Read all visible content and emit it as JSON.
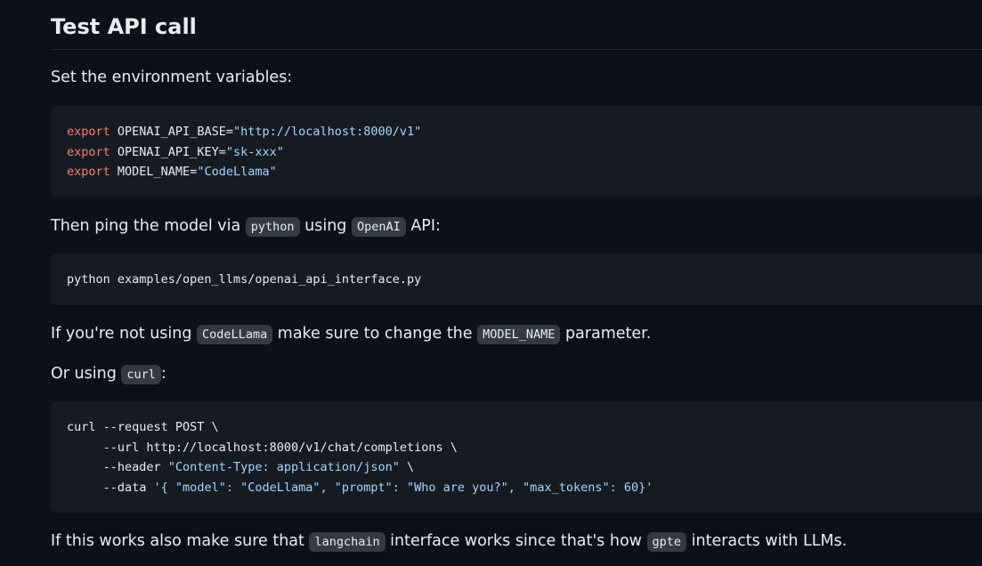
{
  "heading": "Test API call",
  "p1": "Set the environment variables:",
  "env_block": {
    "lines": [
      {
        "kw": "export",
        "name": " OPENAI_API_BASE=",
        "value": "\"http://localhost:8000/v1\""
      },
      {
        "kw": "export",
        "name": " OPENAI_API_KEY=",
        "value": "\"sk-xxx\""
      },
      {
        "kw": "export",
        "name": " MODEL_NAME=",
        "value": "\"CodeLlama\""
      }
    ]
  },
  "p2": {
    "before": "Then ping the model via ",
    "code1": "python",
    "mid": " using ",
    "code2": "OpenAI",
    "after": " API:"
  },
  "python_cmd": "python examples/open_llms/openai_api_interface.py",
  "p3": {
    "before": "If you're not using ",
    "code1": "CodeLLama",
    "mid": " make sure to change the ",
    "code2": "MODEL_NAME",
    "after": " parameter."
  },
  "p4": {
    "before": "Or using ",
    "code1": "curl",
    "after": ":"
  },
  "curl_block": {
    "line1": "curl --request POST \\",
    "line2": "     --url http://localhost:8000/v1/chat/completions \\",
    "line3_pre": "     --header ",
    "line3_str": "\"Content-Type: application/json\"",
    "line3_post": " \\",
    "line4_pre": "     --data ",
    "line4_str": "'{ \"model\": \"CodeLlama\", \"prompt\": \"Who are you?\", \"max_tokens\": 60}'"
  },
  "p5": {
    "before": "If this works also make sure that ",
    "code1": "langchain",
    "mid": " interface works since that's how ",
    "code2": "gpte",
    "after": " interacts with LLMs."
  }
}
